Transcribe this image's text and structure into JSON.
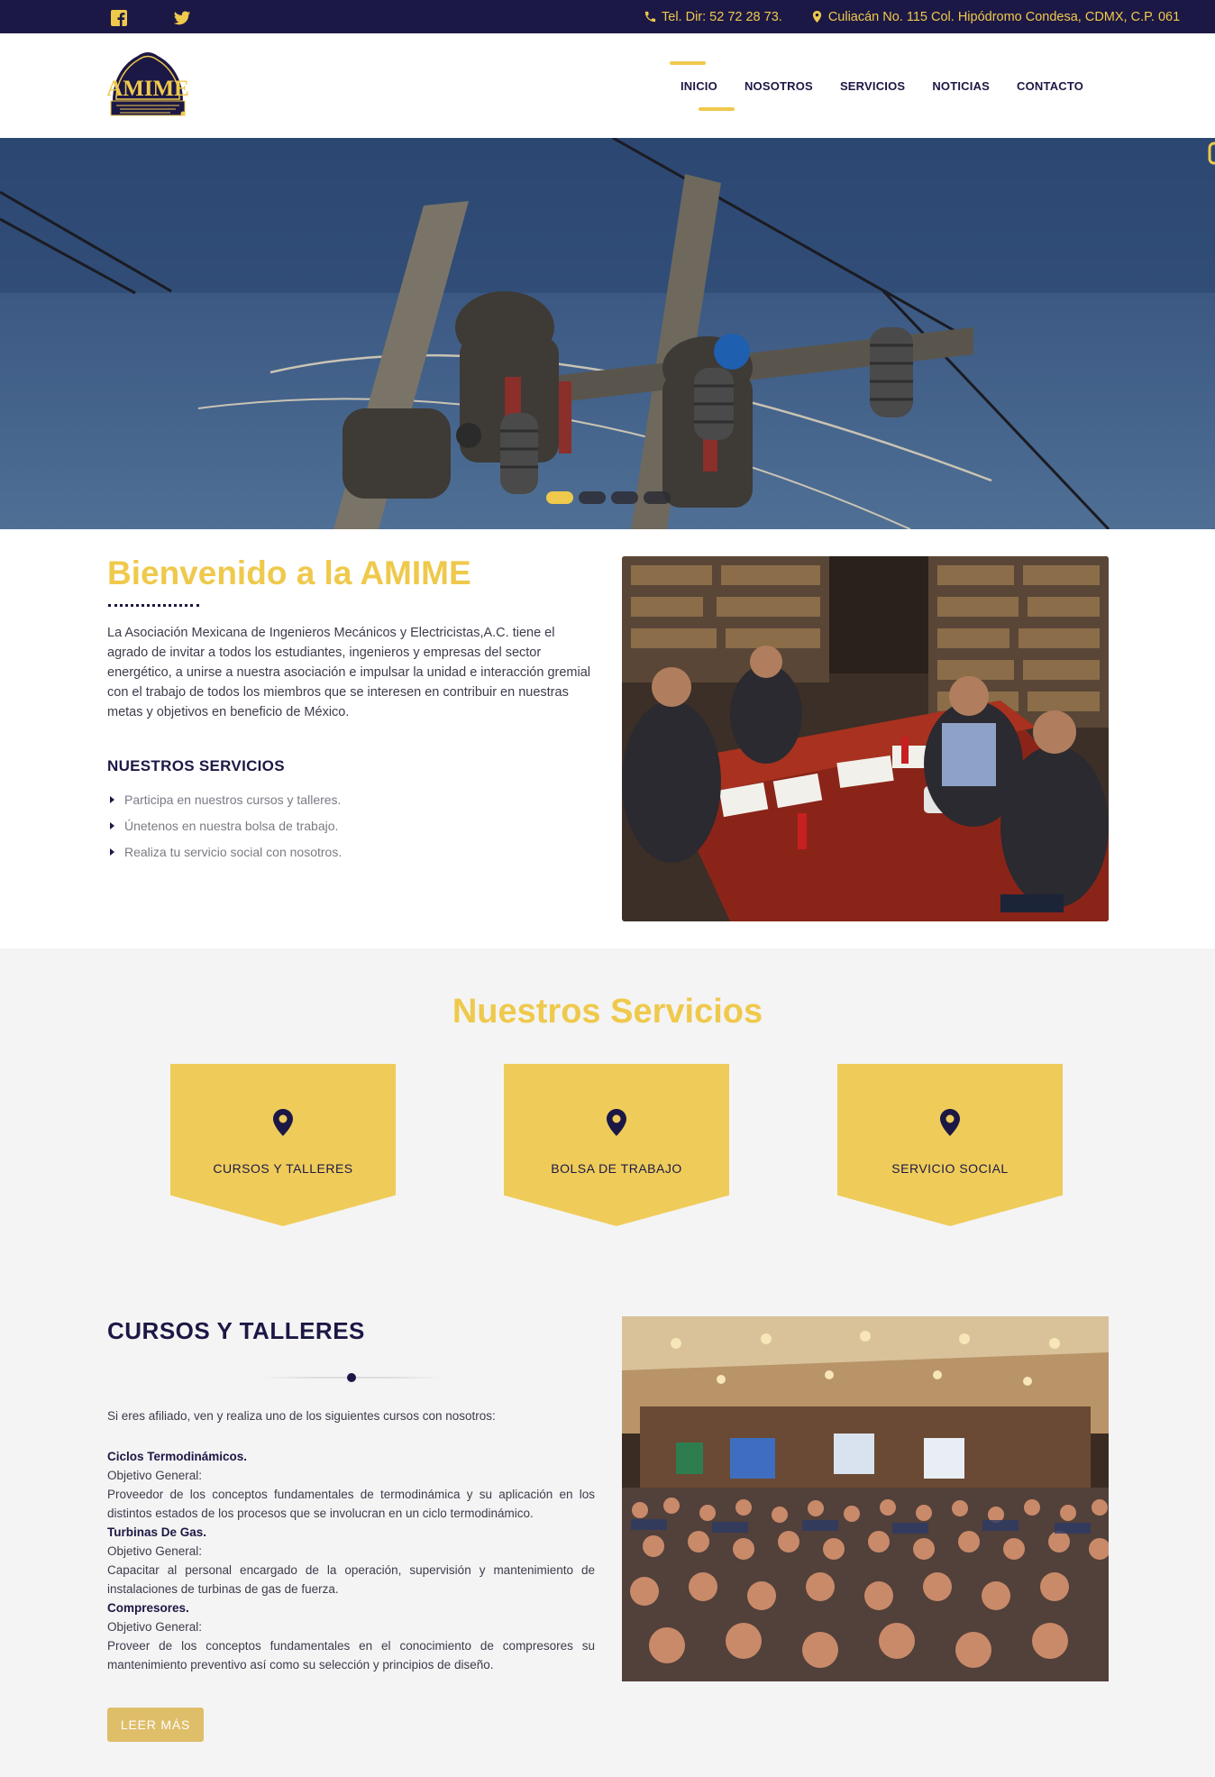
{
  "topbar": {
    "phone": "Tel. Dir: 52 72 28 73.",
    "address": "Culiacán No. 115 Col. Hipódromo Condesa, CDMX, C.P. 061",
    "icons": [
      "facebook-icon",
      "twitter-icon",
      "phone-icon",
      "map-marker-icon"
    ]
  },
  "logo": {
    "text": "AMIME"
  },
  "nav": {
    "items": [
      {
        "label": "INICIO",
        "active": true
      },
      {
        "label": "NOSOTROS"
      },
      {
        "label": "SERVICIOS"
      },
      {
        "label": "NOTICIAS"
      },
      {
        "label": "CONTACTO"
      }
    ]
  },
  "hero": {
    "slides": 4,
    "active_slide": 1
  },
  "welcome": {
    "title": "Bienvenido a la AMIME",
    "text": "La Asociación Mexicana de Ingenieros Mecánicos y Electricistas,A.C. tiene el agrado de invitar a todos los estudiantes, ingenieros y empresas del sector energético, a unirse a nuestra asociación e impulsar la unidad e interacción gremial con el trabajo de todos los miembros que se interesen en contribuir en nuestras metas y objetivos en beneficio de México.",
    "services_heading": "NUESTROS SERVICIOS",
    "services": [
      "Participa en nuestros cursos y talleres.",
      "Únetenos en nuestra bolsa de trabajo.",
      "Realiza tu servicio social con nosotros."
    ]
  },
  "services_section": {
    "title": "Nuestros Servicios",
    "cards": [
      {
        "label": "CURSOS Y TALLERES"
      },
      {
        "label": "BOLSA DE TRABAJO"
      },
      {
        "label": "SERVICIO SOCIAL"
      }
    ]
  },
  "cursos": {
    "title": "CURSOS Y TALLERES",
    "intro": "Si eres afiliado, ven y realiza uno de los siguientes cursos con nosotros:",
    "courses": [
      {
        "name": "Ciclos Termodinámicos.",
        "objective_label": "Objetivo General:",
        "objective": "Proveedor de los conceptos fundamentales de termodinámica y su aplicación en los distintos estados de los procesos que se involucran en un ciclo termodinámico."
      },
      {
        "name": "Turbinas De Gas.",
        "objective_label": "Objetivo General:",
        "objective": "Capacitar al personal encargado de la operación, supervisión y mantenimiento de instalaciones de turbinas de gas de fuerza."
      },
      {
        "name": "Compresores.",
        "objective_label": "Objetivo General:",
        "objective": "Proveer de los conceptos fundamentales en el conocimiento de compresores su mantenimiento preventivo así como su selección y principios de diseño."
      }
    ],
    "button_label": "LEER MÁS"
  },
  "colors": {
    "navy": "#1c1845",
    "gold": "#efc94c",
    "band": "#f4f4f4",
    "button": "#dfbe6a"
  }
}
